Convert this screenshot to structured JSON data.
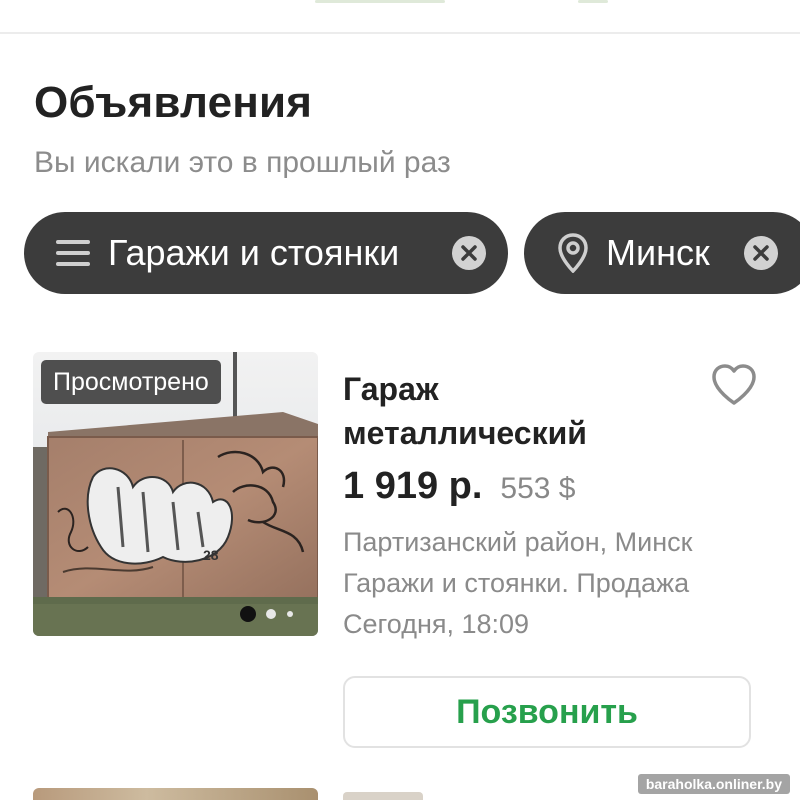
{
  "header": {
    "title": "Объявления",
    "subtitle": "Вы искали это в прошлый раз"
  },
  "filters": {
    "category": {
      "label": "Гаражи и стоянки",
      "icon": "menu-icon"
    },
    "location": {
      "label": "Минск",
      "icon": "map-pin-icon"
    }
  },
  "listing": {
    "badge": "Просмотрено",
    "title": "Гараж металлический",
    "price_byn": "1 919 р.",
    "price_usd": "553 $",
    "district": "Партизанский район, Минск",
    "category": "Гаражи и стоянки. Продажа",
    "date": "Сегодня, 18:09",
    "call_label": "Позвонить",
    "photo_count": 3,
    "photo_current": 1
  },
  "watermark": "baraholka.onliner.by",
  "colors": {
    "chip_bg": "#3c3c3c",
    "accent_green": "#27a04c",
    "muted_text": "#8a8a8a"
  }
}
